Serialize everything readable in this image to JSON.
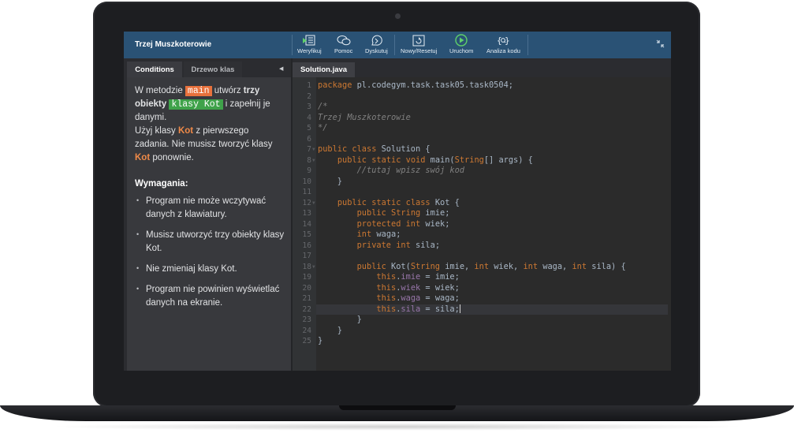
{
  "app": {
    "title": "Trzej Muszkoterowie"
  },
  "toolbar": [
    {
      "id": "verify",
      "label": "Weryfikuj",
      "icon": "verify-icon"
    },
    {
      "id": "help",
      "label": "Pomoc",
      "icon": "help-chat-icon"
    },
    {
      "id": "discuss",
      "label": "Dyskutuj",
      "icon": "discuss-icon"
    },
    {
      "id": "reset",
      "label": "Nowy/Resetuj",
      "icon": "reset-icon"
    },
    {
      "id": "run",
      "label": "Uruchom",
      "icon": "play-icon"
    },
    {
      "id": "analyze",
      "label": "Analiza kodu",
      "icon": "code-analysis-icon"
    }
  ],
  "left": {
    "tabs": [
      "Conditions",
      "Drzewo klas"
    ],
    "intro": {
      "p1a": "W metodzie ",
      "main": "main",
      "p1b": " utwórz ",
      "bold1": "trzy obiekty",
      "kot": "klasy Kot",
      "p1c": " i zapełnij je danymi.",
      "p2a": "Użyj klasy ",
      "kotWord": "Kot",
      "p2b": " z pierwszego zadania. Nie musisz tworzyć klasy ",
      "kotWord2": "Kot",
      "p2c": " ponownie."
    },
    "requirements_title": "Wymagania:",
    "requirements": [
      "Program nie może wczytywać danych z klawiatury.",
      "Musisz utworzyć trzy obiekty klasy Kot.",
      "Nie zmieniaj klasy Kot.",
      "Program nie powinien wyświetlać danych na ekranie."
    ]
  },
  "editor": {
    "tab": "Solution.java",
    "active_line": 22,
    "lines": [
      "package pl.codegym.task.task05.task0504;",
      "",
      "/*",
      "Trzej Muszkoterowie",
      "*/",
      "",
      "public class Solution {",
      "    public static void main(String[] args) {",
      "        //tutaj wpisz swój kod",
      "    }",
      "",
      "    public static class Kot {",
      "        public String imie;",
      "        protected int wiek;",
      "        int waga;",
      "        private int sila;",
      "",
      "        public Kot(String imie, int wiek, int waga, int sila) {",
      "            this.imie = imie;",
      "            this.wiek = wiek;",
      "            this.waga = waga;",
      "            this.sila = sila;",
      "        }",
      "    }",
      "}"
    ]
  },
  "colors": {
    "toolbar": "#2a5275",
    "accent_orange": "#e8713c",
    "accent_green": "#3fa24a"
  }
}
